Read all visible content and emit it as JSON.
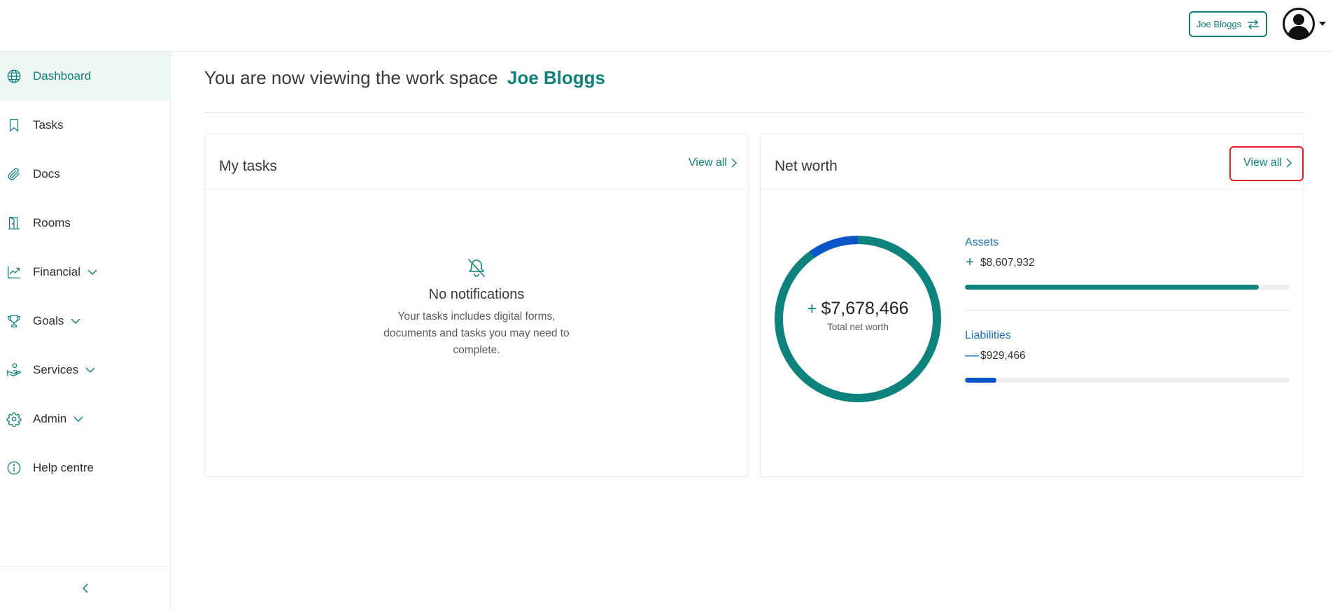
{
  "topbar": {
    "workspace_button_label": "Joe Bloggs"
  },
  "sidebar": {
    "items": [
      {
        "label": "Dashboard",
        "icon": "globe-icon",
        "active": true
      },
      {
        "label": "Tasks",
        "icon": "bookmark-icon"
      },
      {
        "label": "Docs",
        "icon": "paperclip-icon"
      },
      {
        "label": "Rooms",
        "icon": "door-icon"
      },
      {
        "label": "Financial",
        "icon": "chart-line-icon",
        "expandable": true
      },
      {
        "label": "Goals",
        "icon": "trophy-icon",
        "expandable": true
      },
      {
        "label": "Services",
        "icon": "hand-coin-icon",
        "expandable": true
      },
      {
        "label": "Admin",
        "icon": "gear-icon",
        "expandable": true
      },
      {
        "label": "Help centre",
        "icon": "info-icon"
      }
    ]
  },
  "header": {
    "title_prefix": "You are now viewing the work space",
    "workspace_name": "Joe Bloggs"
  },
  "tasks_card": {
    "title": "My tasks",
    "view_all_label": "View all",
    "empty_title": "No notifications",
    "empty_description": "Your tasks includes digital forms, documents and tasks you may need to complete."
  },
  "networth_card": {
    "title": "Net worth",
    "view_all_label": "View all",
    "total_sign": "+",
    "total_value": "$7,678,466",
    "total_label": "Total net worth",
    "assets_label": "Assets",
    "assets_sign": "+",
    "assets_value": "$8,607,932",
    "assets_fraction": 0.905,
    "liabilities_label": "Liabilities",
    "liabilities_sign": "—",
    "liabilities_value": "$929,466",
    "liabilities_fraction": 0.098,
    "donut_share_assets": 0.902,
    "donut_share_liabilities": 0.098
  },
  "colors": {
    "brand": "#0e7f7a",
    "liabilities": "#0a56c9",
    "assets": "#0e837d",
    "highlight": "#e32020"
  }
}
